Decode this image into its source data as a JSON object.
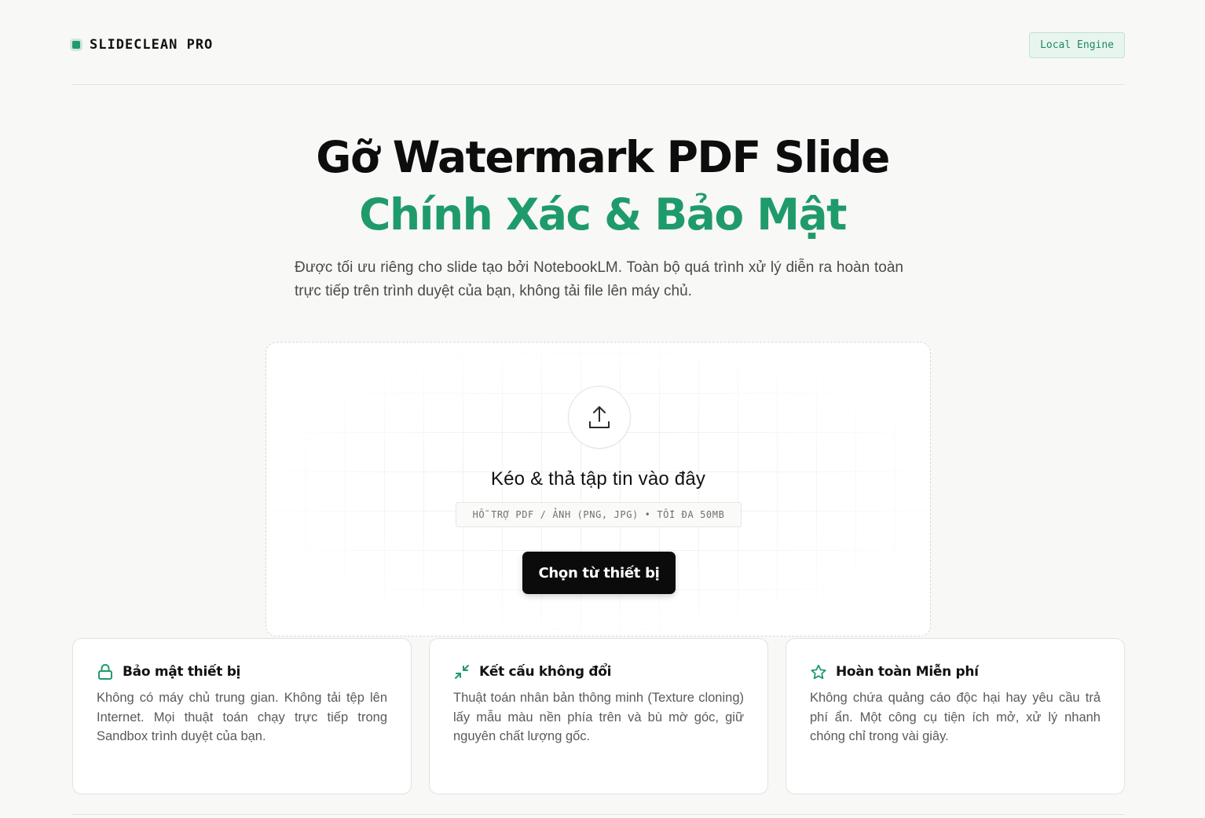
{
  "header": {
    "brand": "SLIDECLEAN PRO",
    "engine_badge": "Local Engine"
  },
  "hero": {
    "title_line1": "Gỡ Watermark PDF Slide",
    "title_line2": "Chính Xác & Bảo Mật",
    "description": "Được tối ưu riêng cho slide tạo bởi NotebookLM. Toàn bộ quá trình xử lý diễn ra hoàn toàn trực tiếp trên trình duyệt của bạn, không tải file lên máy chủ."
  },
  "upload": {
    "icon": "upload-icon",
    "title": "Kéo & thả tập tin vào đây",
    "hint": "HỖ TRỢ PDF / ẢNH (PNG, JPG) • TỐI ĐA 50MB",
    "button_label": "Chọn từ thiết bị"
  },
  "features": [
    {
      "icon": "lock-icon",
      "title": "Bảo mật thiết bị",
      "text": "Không có máy chủ trung gian. Không tải tệp lên Internet. Mọi thuật toán chạy trực tiếp trong Sandbox trình duyệt của bạn."
    },
    {
      "icon": "minimize-arrows-icon",
      "title": "Kết cấu không đổi",
      "text": "Thuật toán nhân bản thông minh (Texture cloning) lấy mẫu màu nền phía trên và bù mờ góc, giữ nguyên chất lượng gốc."
    },
    {
      "icon": "star-icon",
      "title": "Hoàn toàn Miễn phí",
      "text": "Không chứa quảng cáo độc hại hay yêu cầu trả phí ẩn. Một công cụ tiện ích mở, xử lý nhanh chóng chỉ trong vài giây."
    }
  ],
  "colors": {
    "accent": "#1f9b6b",
    "background": "#f8f8f7",
    "button": "#0b0b0b"
  }
}
